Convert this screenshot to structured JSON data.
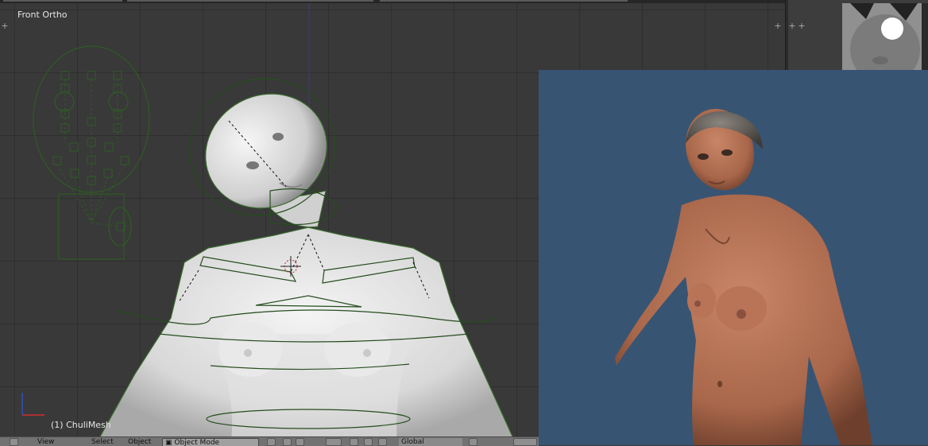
{
  "viewport": {
    "view_name": "Front Ortho",
    "object_name": "(1) ChuliMesh"
  },
  "header": {
    "view_menu": "View",
    "select_menu": "Select",
    "object_menu": "Object",
    "mode_select": "Object Mode",
    "shading_label": "Global"
  },
  "colors": {
    "viewport_bg": "#393939",
    "wire_green": "#3a6b2e",
    "render_bg": "#385473",
    "skin": "#b87458"
  },
  "icons": [
    "viewport-type-icon",
    "mode-icon",
    "shading-icon",
    "pivot-icon",
    "manipulator-icon",
    "layers-icon",
    "snap-icon"
  ]
}
